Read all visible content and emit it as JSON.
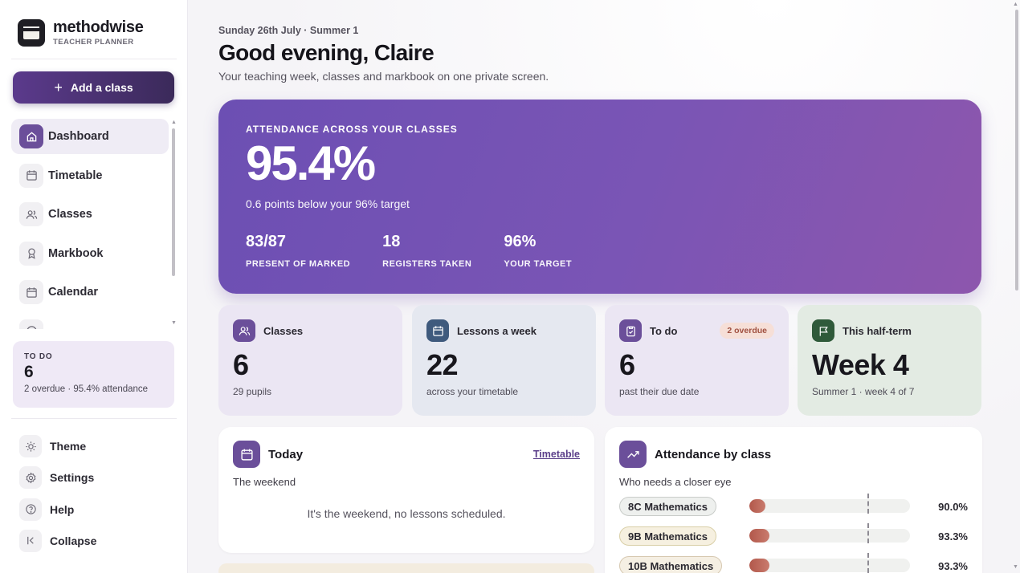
{
  "brand": {
    "name": "methodwise",
    "subtitle": "TEACHER PLANNER"
  },
  "sidebar": {
    "add_class_label": "Add a class",
    "nav": [
      {
        "label": "Dashboard",
        "icon": "home-icon",
        "active": true
      },
      {
        "label": "Timetable",
        "icon": "calendar-icon"
      },
      {
        "label": "Classes",
        "icon": "users-icon"
      },
      {
        "label": "Markbook",
        "icon": "award-icon"
      },
      {
        "label": "Calendar",
        "icon": "calendar-icon"
      }
    ],
    "todo": {
      "label": "TO DO",
      "count": "6",
      "summary": "2 overdue · 95.4% attendance"
    },
    "bottom": [
      {
        "label": "Theme",
        "icon": "sun-icon"
      },
      {
        "label": "Settings",
        "icon": "gear-icon"
      },
      {
        "label": "Help",
        "icon": "help-icon"
      },
      {
        "label": "Collapse",
        "icon": "collapse-icon"
      }
    ]
  },
  "header": {
    "date_line": "Sunday 26th July · Summer 1",
    "greeting": "Good evening, Claire",
    "subtitle": "Your teaching week, classes and markbook on one private screen."
  },
  "hero": {
    "label": "ATTENDANCE ACROSS YOUR CLASSES",
    "value": "95.4%",
    "sub": "0.6 points below your 96% target",
    "stats": [
      {
        "value": "83/87",
        "label": "PRESENT OF MARKED"
      },
      {
        "value": "18",
        "label": "REGISTERS TAKEN"
      },
      {
        "value": "96%",
        "label": "YOUR TARGET"
      }
    ]
  },
  "stats": [
    {
      "title": "Classes",
      "value": "6",
      "sub": "29 pupils",
      "icon": "users-icon",
      "bg": "#ebe6f3",
      "icon_bg": "#6b4f9a"
    },
    {
      "title": "Lessons a week",
      "value": "22",
      "sub": "across your timetable",
      "icon": "calendar-icon",
      "bg": "#e5e8f0",
      "icon_bg": "#3f5a7d"
    },
    {
      "title": "To do",
      "value": "6",
      "sub": "past their due date",
      "badge": "2 overdue",
      "icon": "clipboard-icon",
      "bg": "#ebe6f3",
      "icon_bg": "#6b4f9a"
    },
    {
      "title": "This half-term",
      "value": "Week 4",
      "sub": "Summer 1 · week 4 of 7",
      "icon": "flag-icon",
      "bg": "#e3ebe3",
      "icon_bg": "#2f5a3a"
    }
  ],
  "today": {
    "title": "Today",
    "link": "Timetable",
    "sub": "The weekend",
    "empty": "It's the weekend, no lessons scheduled."
  },
  "attendance": {
    "title": "Attendance by class",
    "sub": "Who needs a closer eye",
    "target_pct": 96,
    "rows": [
      {
        "class": "8C Mathematics",
        "pct": 90.0,
        "label": "90.0%",
        "pill_bg": "#eef0ee",
        "pill_border": "#c9ccc9"
      },
      {
        "class": "9B Mathematics",
        "pct": 93.3,
        "label": "93.3%",
        "pill_bg": "#f6f0e0",
        "pill_border": "#d9cfa8"
      },
      {
        "class": "10B Mathematics",
        "pct": 93.3,
        "label": "93.3%",
        "pill_bg": "#f5efe3",
        "pill_border": "#d6c8b0"
      }
    ]
  }
}
